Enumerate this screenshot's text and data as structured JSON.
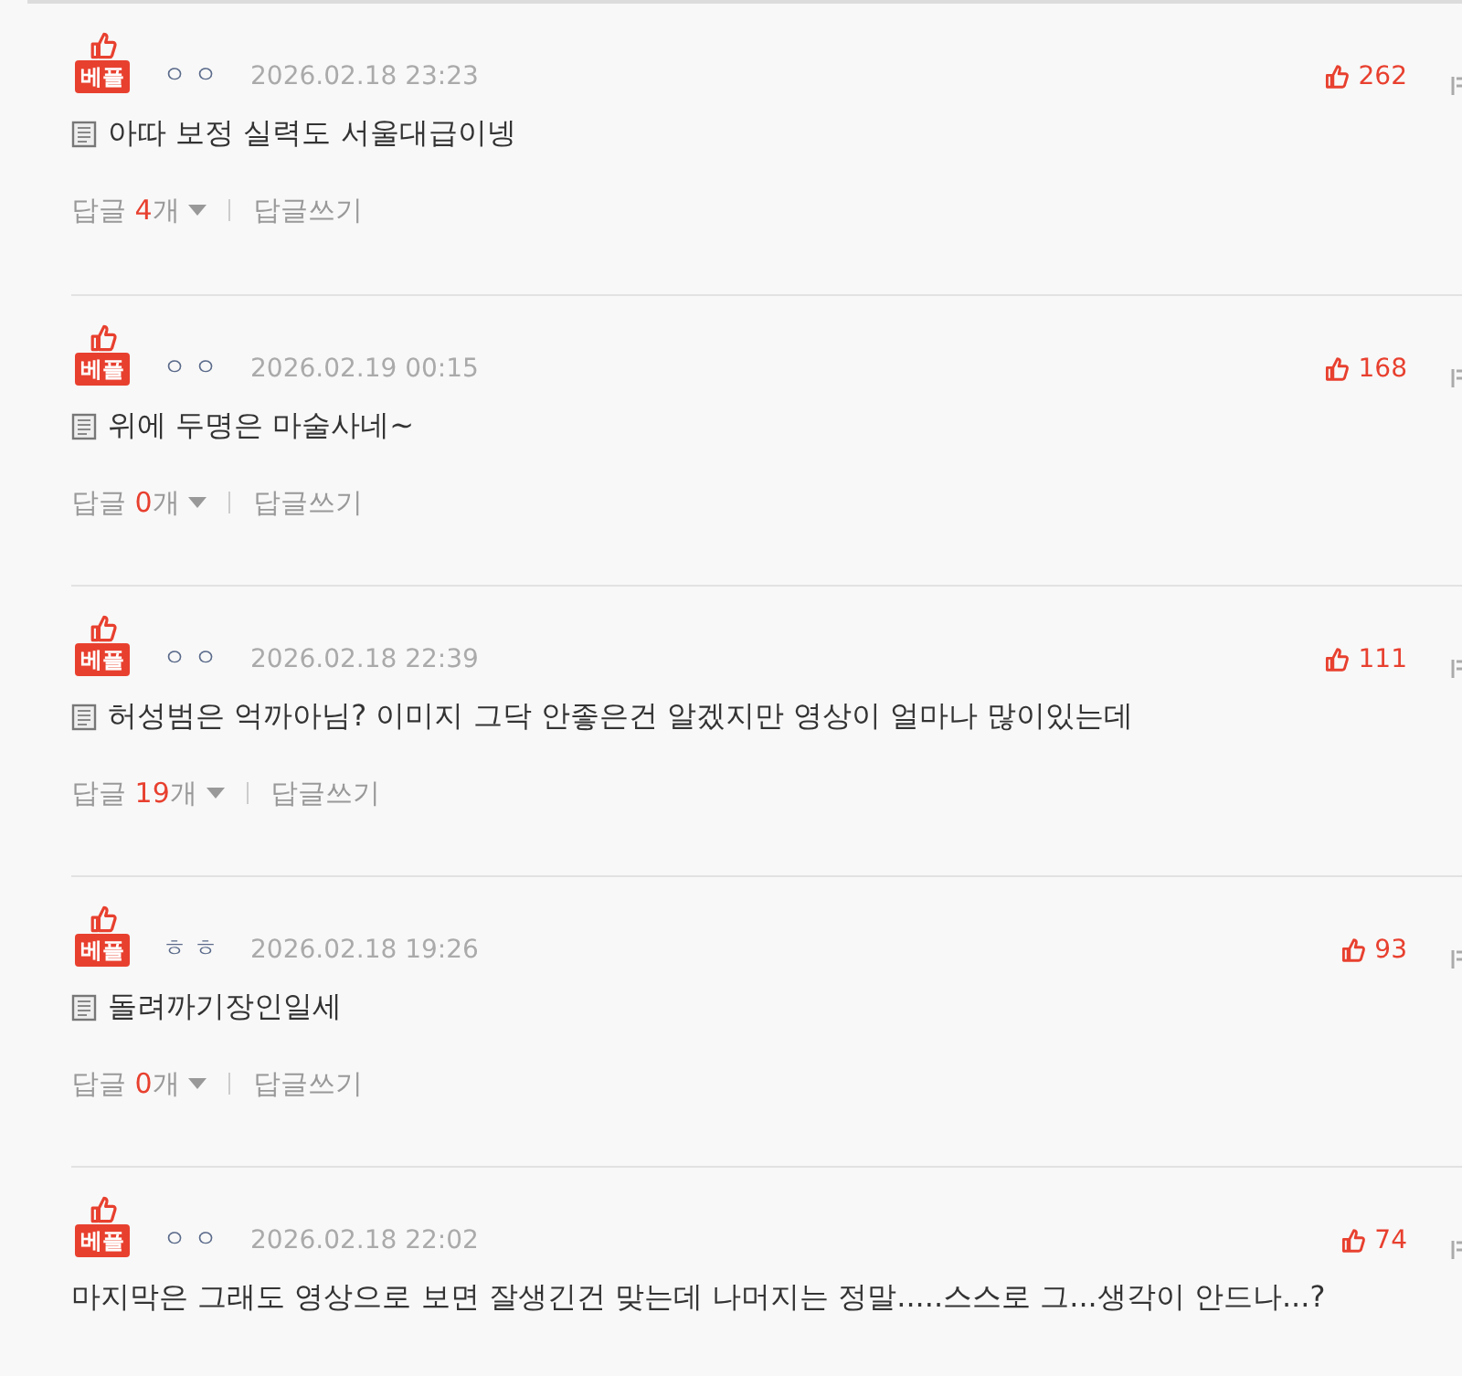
{
  "comments": [
    {
      "best_badge": "베플",
      "nickname": "ㅇㅇ",
      "date": "2026.02.18 23:23",
      "likes": "262",
      "memo": true,
      "text": "아따 보정 실력도 서울대급이넹",
      "reply_label": "답글",
      "reply_count": "4",
      "reply_unit": "개",
      "write_reply": "답글쓰기"
    },
    {
      "best_badge": "베플",
      "nickname": "ㅇㅇ",
      "date": "2026.02.19 00:15",
      "likes": "168",
      "memo": true,
      "text": "위에 두명은 마술사네~",
      "reply_label": "답글",
      "reply_count": "0",
      "reply_unit": "개",
      "write_reply": "답글쓰기"
    },
    {
      "best_badge": "베플",
      "nickname": "ㅇㅇ",
      "date": "2026.02.18 22:39",
      "likes": "111",
      "memo": true,
      "text": "허성범은 억까아님? 이미지 그닥 안좋은건 알겠지만 영상이 얼마나 많이있는데",
      "reply_label": "답글",
      "reply_count": "19",
      "reply_unit": "개",
      "write_reply": "답글쓰기"
    },
    {
      "best_badge": "베플",
      "nickname": "ㅎㅎ",
      "date": "2026.02.18 19:26",
      "likes": "93",
      "memo": true,
      "text": "돌려까기장인일세",
      "reply_label": "답글",
      "reply_count": "0",
      "reply_unit": "개",
      "write_reply": "답글쓰기"
    },
    {
      "best_badge": "베플",
      "nickname": "ㅇㅇ",
      "date": "2026.02.18 22:02",
      "likes": "74",
      "memo": false,
      "text": "마지막은 그래도 영상으로 보면 잘생긴건 맞는데 나머지는 정말.....스스로 그...생각이 안드나...?"
    }
  ]
}
